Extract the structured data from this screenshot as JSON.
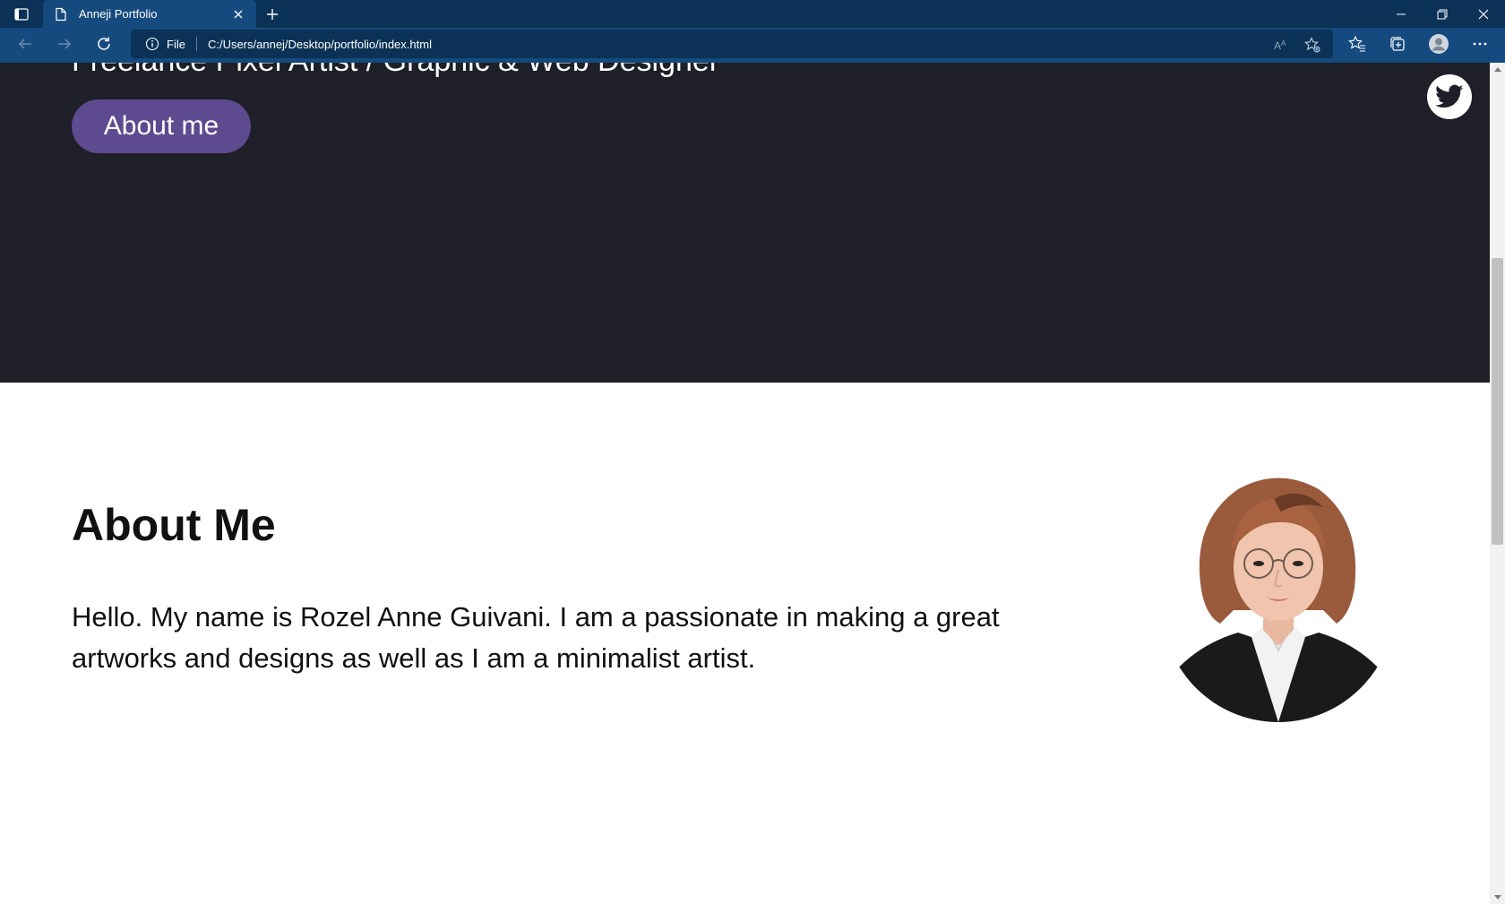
{
  "browser": {
    "tab_title": "Anneji Portfolio",
    "address_scheme": "File",
    "url": "C:/Users/annej/Desktop/portfolio/index.html",
    "icons": [
      "tab-actions-icon",
      "page-icon",
      "close-icon",
      "plus-icon",
      "minimize-icon",
      "restore-icon",
      "close-window-icon",
      "back-arrow-icon",
      "forward-arrow-icon",
      "refresh-icon",
      "info-icon",
      "read-aloud-icon",
      "add-favorite-icon",
      "favorites-icon",
      "collections-icon",
      "profile-icon",
      "more-icon"
    ]
  },
  "hero": {
    "subtitle": "Freelance Pixel Artist / Graphic & Web Designer",
    "about_button": "About me",
    "background": "#1e1f28",
    "button_color": "#5e4a8f"
  },
  "about": {
    "title": "About Me",
    "text": "Hello. My name is Rozel Anne Guivani. I am a passionate in making a great artworks and designs as well as I am a minimalist artist."
  },
  "colors": {
    "chrome_dark": "#0b3256",
    "chrome_tab": "#154a7e"
  }
}
